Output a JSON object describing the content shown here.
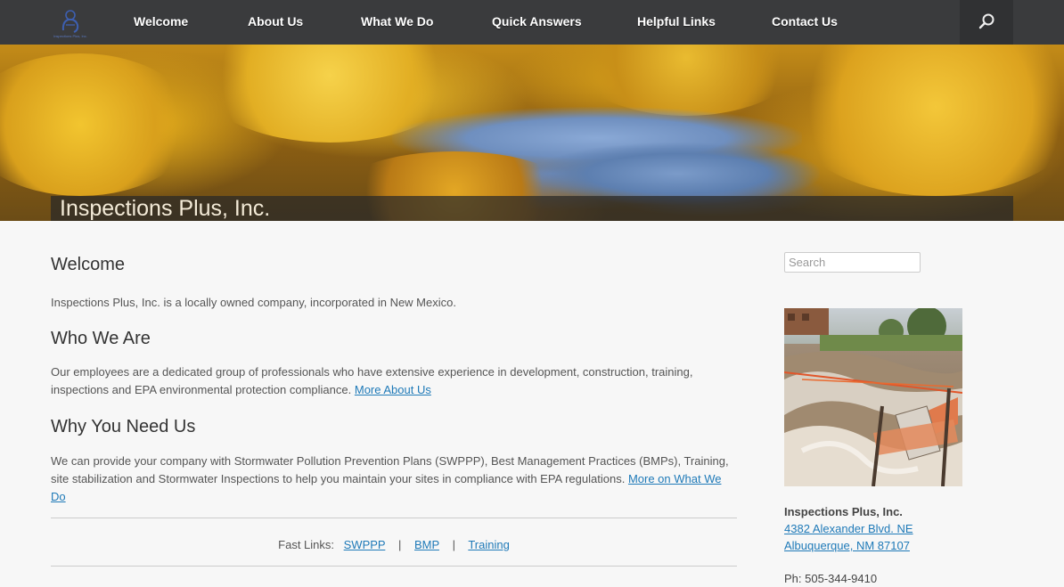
{
  "nav": {
    "logo_text": "Inspections Plus, Inc.",
    "items": [
      {
        "label": "Welcome"
      },
      {
        "label": "About Us"
      },
      {
        "label": "What We Do"
      },
      {
        "label": "Quick Answers"
      },
      {
        "label": "Helpful Links"
      },
      {
        "label": "Contact Us"
      }
    ],
    "search_icon": "search-icon"
  },
  "hero": {
    "title": "Inspections Plus, Inc."
  },
  "main": {
    "welcome_heading": "Welcome",
    "welcome_text": "Inspections Plus, Inc. is a locally owned company, incorporated in New Mexico.",
    "who_heading": "Who We Are",
    "who_text": "Our employees are a dedicated group of professionals who have extensive experience in development, construction, training, inspections and EPA environmental protection compliance.",
    "who_link": "More About Us",
    "why_heading": "Why You Need Us",
    "why_text": "We can provide your company with Stormwater Pollution Prevention Plans (SWPPP), Best Management Practices (BMPs), Training, site stabilization and Stormwater Inspections to help you maintain your sites in compliance with EPA regulations.",
    "why_link": "More on What We Do",
    "fast_links_label": "Fast Links:",
    "fast_links": [
      "SWPPP",
      "BMP",
      "Training"
    ],
    "fast_links_sep": "|"
  },
  "sidebar": {
    "search_placeholder": "Search",
    "company": "Inspections Plus, Inc.",
    "address_line1": "4382 Alexander Blvd. NE",
    "address_line2": "Albuquerque, NM 87107",
    "phone_partial": "Ph: 505-344-9410"
  },
  "colors": {
    "nav_bg": "#3a3b3d",
    "link": "#1f7ab8",
    "page_bg": "#f7f7f7"
  }
}
